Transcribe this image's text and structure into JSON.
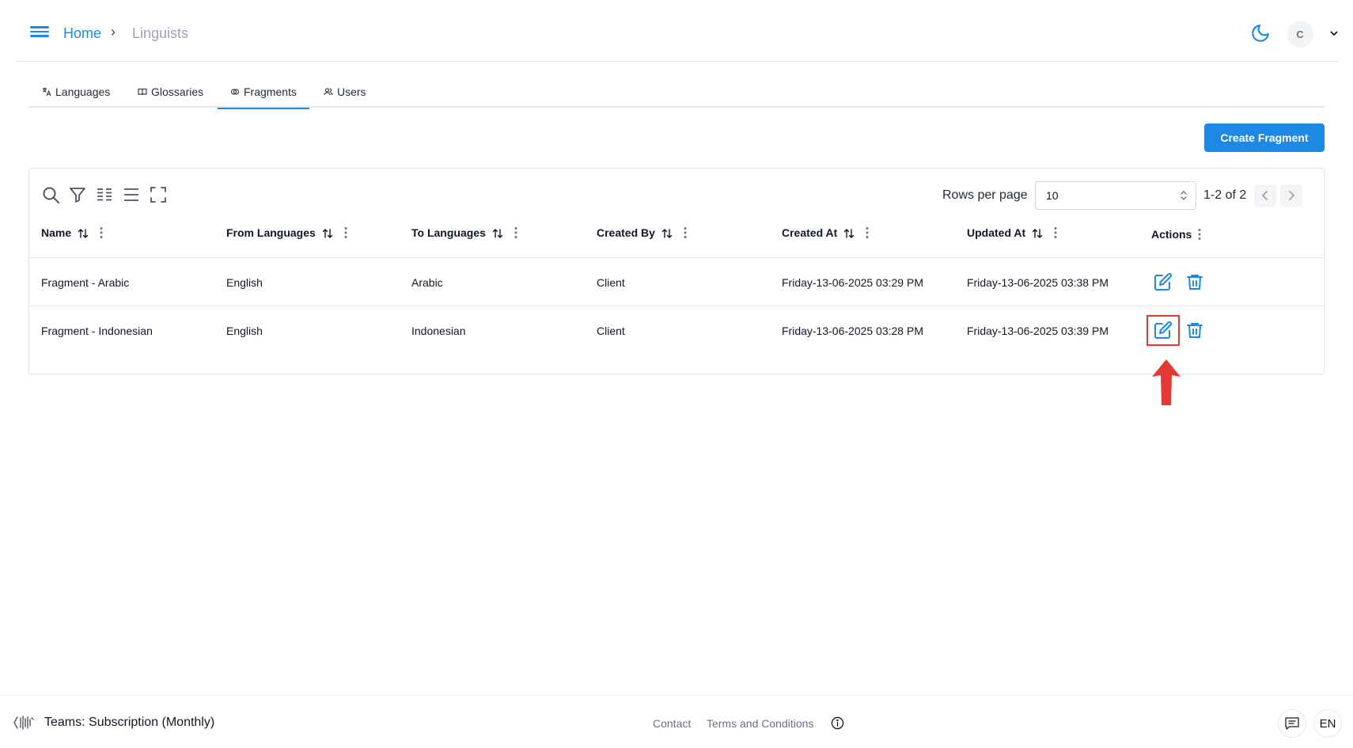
{
  "header": {
    "breadcrumb_home": "Home",
    "breadcrumb_separator": "›",
    "breadcrumb_current": "Linguists",
    "avatar_initial": "C"
  },
  "tabs": [
    {
      "label": "Languages",
      "icon": "translate-icon",
      "active": false
    },
    {
      "label": "Glossaries",
      "icon": "book-icon",
      "active": false
    },
    {
      "label": "Fragments",
      "icon": "fragment-icon",
      "active": true
    },
    {
      "label": "Users",
      "icon": "users-icon",
      "active": false
    }
  ],
  "create_button": "Create Fragment",
  "toolbar": {
    "icons": [
      "search-icon",
      "filter-icon",
      "columns-icon",
      "density-icon",
      "fullscreen-icon"
    ],
    "rows_per_page_label": "Rows per page",
    "rows_per_page_value": "10",
    "pagination_text": "1-2 of 2"
  },
  "table": {
    "columns": [
      "Name",
      "From Languages",
      "To Languages",
      "Created By",
      "Created At",
      "Updated At",
      "Actions"
    ],
    "rows": [
      {
        "name": "Fragment - Arabic",
        "from": "English",
        "to": "Arabic",
        "created_by": "Client",
        "created_at": "Friday-13-06-2025 03:29 PM",
        "updated_at": "Friday-13-06-2025 03:38 PM"
      },
      {
        "name": "Fragment - Indonesian",
        "from": "English",
        "to": "Indonesian",
        "created_by": "Client",
        "created_at": "Friday-13-06-2025 03:28 PM",
        "updated_at": "Friday-13-06-2025 03:39 PM"
      }
    ]
  },
  "footer": {
    "subscription": "Teams: Subscription (Monthly)",
    "contact": "Contact",
    "terms": "Terms and Conditions",
    "language": "EN"
  },
  "colors": {
    "accent": "#1e88e5",
    "highlight": "#e53935"
  }
}
